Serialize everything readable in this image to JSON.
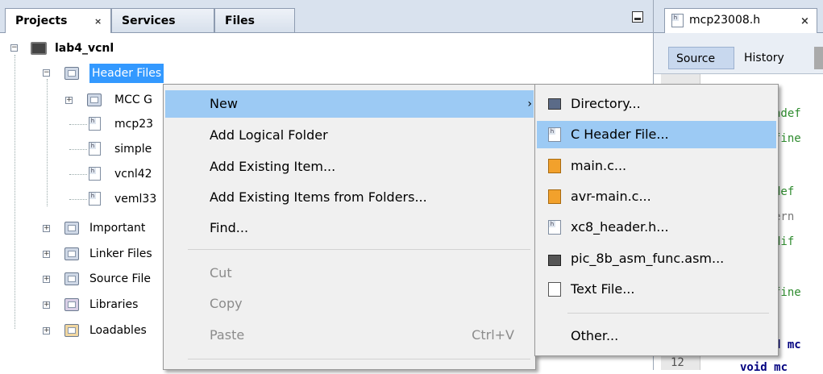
{
  "projects_panel": {
    "tabs": [
      {
        "label": "Projects",
        "close": "×"
      },
      {
        "label": "Services"
      },
      {
        "label": "Files"
      }
    ],
    "tree": {
      "project": "lab4_vcnl",
      "header_files": "Header Files",
      "header_children": [
        "MCC G",
        "mcp23",
        "simple",
        "vcnl42",
        "veml33"
      ],
      "other_folders": [
        "Important",
        "Linker Files",
        "Source File",
        "Libraries",
        "Loadables"
      ]
    }
  },
  "editor": {
    "tab_label": "mcp23008.h",
    "tab_close": "×",
    "toolbar": {
      "source": "Source",
      "history": "History"
    },
    "code_fragments": [
      "ndef",
      "fine",
      "def",
      "ern",
      "dif",
      "fine",
      "d mc",
      "void mc"
    ],
    "line_number": "12"
  },
  "context_menu": {
    "items": [
      {
        "label": "New",
        "arrow": "›"
      },
      {
        "label": "Add Logical Folder"
      },
      {
        "label": "Add Existing Item..."
      },
      {
        "label": "Add Existing Items from Folders..."
      },
      {
        "label": "Find..."
      },
      {
        "label": "Cut"
      },
      {
        "label": "Copy"
      },
      {
        "label": "Paste",
        "shortcut": "Ctrl+V"
      }
    ]
  },
  "new_submenu": {
    "items": [
      {
        "label": "Directory...",
        "icon": "folder-icon"
      },
      {
        "label": "C Header File...",
        "icon": "header-file-icon"
      },
      {
        "label": "main.c...",
        "icon": "c-file-icon"
      },
      {
        "label": "avr-main.c...",
        "icon": "c-file-icon"
      },
      {
        "label": "xc8_header.h...",
        "icon": "header-file-icon"
      },
      {
        "label": "pic_8b_asm_func.asm...",
        "icon": "asm-file-icon"
      },
      {
        "label": "Text File...",
        "icon": "text-file-icon"
      },
      {
        "label": "Other..."
      }
    ]
  },
  "colors": {
    "selection": "#3399ff",
    "menu_highlight": "#9ccaf4",
    "code_green": "#2e8b2e",
    "code_gray": "#777777",
    "code_blue": "#00007f"
  }
}
